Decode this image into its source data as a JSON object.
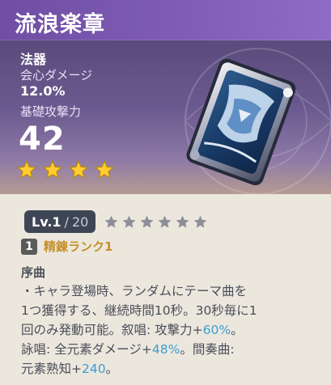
{
  "header": {
    "title": "流浪楽章"
  },
  "stats": {
    "type": "法器",
    "secondary_label": "会心ダメージ",
    "secondary_value": "12.0%",
    "base_atk_label": "基礎攻撃力",
    "base_atk_value": "42"
  },
  "rarity": {
    "stars": 4,
    "star_color": "#ffcc33"
  },
  "level": {
    "prefix": "Lv.",
    "current": "1",
    "separator": "/",
    "max": "20",
    "ascension_stars": 6
  },
  "refinement": {
    "rank_number": "1",
    "label": "精錬ランク1"
  },
  "passive": {
    "name": "序曲",
    "lines": [
      {
        "parts": [
          {
            "text": "・キャラ登場時、ランダムにテーマ曲を",
            "hl": false
          }
        ]
      },
      {
        "parts": [
          {
            "text": "1つ獲得する、継続時間10秒。30秒毎に1",
            "hl": false
          }
        ]
      },
      {
        "parts": [
          {
            "text": "回のみ発動可能。叙唱: 攻撃力+",
            "hl": false
          },
          {
            "text": "60%",
            "hl": true
          },
          {
            "text": "。",
            "hl": false
          }
        ]
      },
      {
        "parts": [
          {
            "text": "詠唱: 全元素ダメージ+",
            "hl": false
          },
          {
            "text": "48%",
            "hl": true
          },
          {
            "text": "。間奏曲:",
            "hl": false
          }
        ]
      },
      {
        "parts": [
          {
            "text": "元素熟知+",
            "hl": false
          },
          {
            "text": "240",
            "hl": true
          },
          {
            "text": "。",
            "hl": false
          }
        ]
      }
    ],
    "highlight_color": "#3c9ed2"
  },
  "icons": {
    "rarity_star": "star-icon",
    "ascension_star": "ascension-star-icon",
    "weapon": "catalyst-book-icon"
  }
}
